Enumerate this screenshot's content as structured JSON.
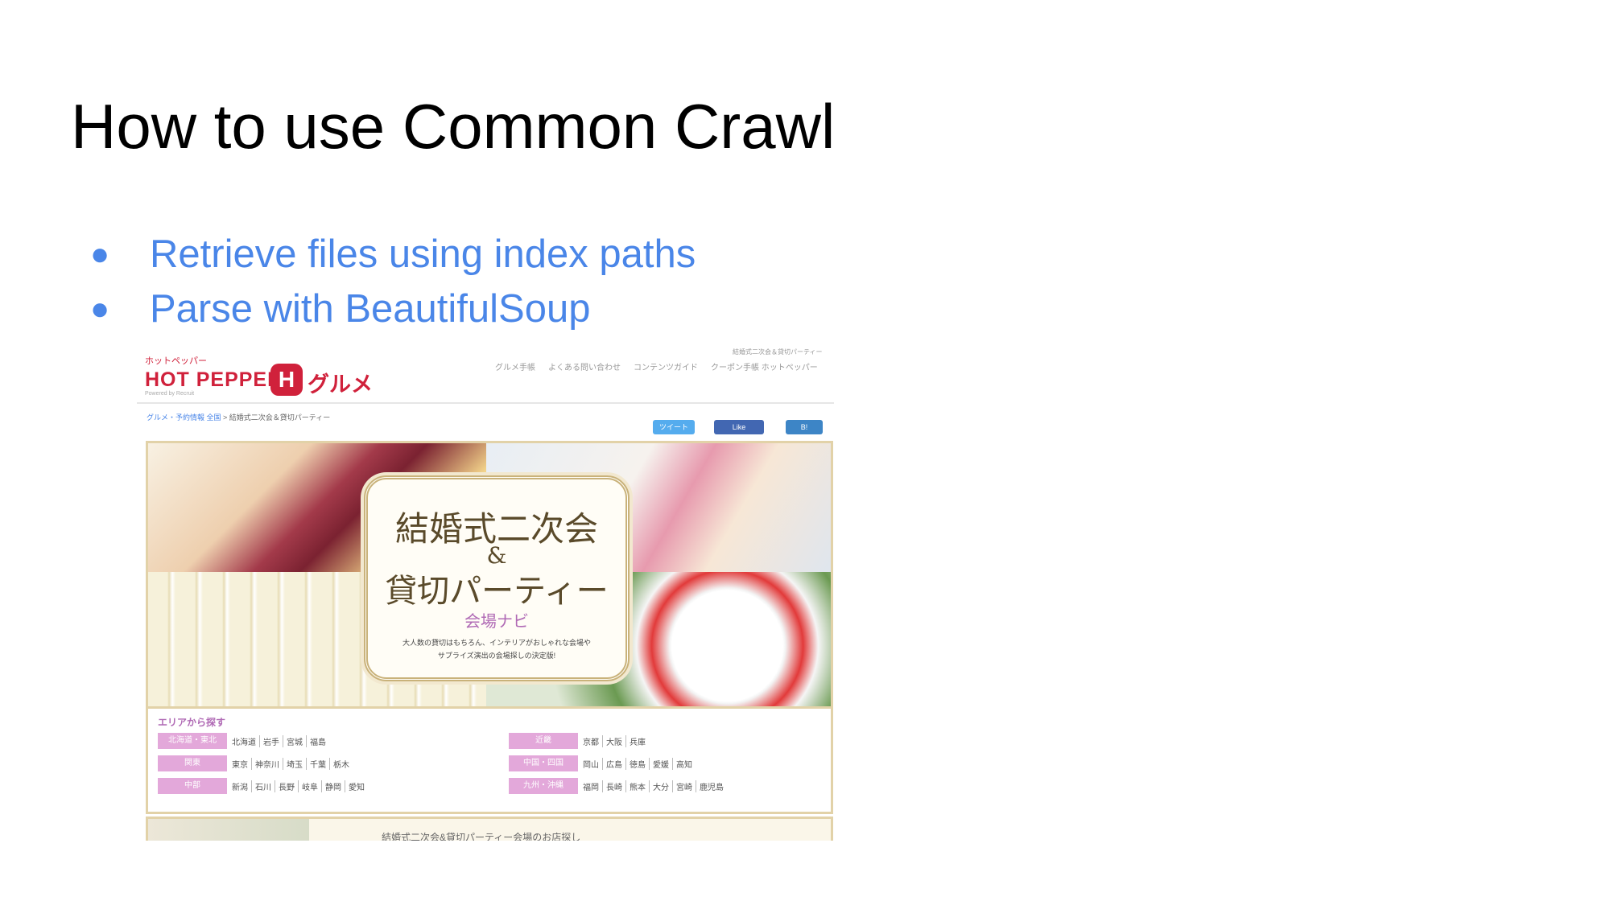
{
  "slide": {
    "title": "How to use Common Crawl",
    "bullets": [
      "Retrieve files using index paths",
      "Parse with BeautifulSoup"
    ],
    "bullet_color": "#4a86e8"
  },
  "website": {
    "logo_kana": "ホットペッパー",
    "logo_main": "HOT PEPPER",
    "logo_h": "H",
    "logo_gourmet": "グルメ",
    "logo_sub": "Powered by Recruit",
    "top_note": "結婚式二次会＆貸切パーティー",
    "nav": [
      "グルメ手帳",
      "よくある問い合わせ",
      "コンテンツガイド",
      "クーポン手帳 ホットペッパー"
    ],
    "breadcrumb_link": "グルメ・予約情報 全国",
    "breadcrumb_current": "結婚式二次会＆貸切パーティー",
    "sns": {
      "tweet": "ツイート",
      "like": "Like",
      "bookmark": "B!"
    },
    "hero": {
      "title1": "結婚式二次会",
      "amp": "&",
      "title2": "貸切パーティー",
      "subtitle": "会場ナビ",
      "desc1": "大人数の貸切はもちろん、インテリアがおしゃれな会場や",
      "desc2": "サプライズ演出の会場探しの決定版!"
    },
    "area_search": {
      "title": "エリアから探す",
      "regions": [
        {
          "name": "北海道・東北",
          "prefs": [
            "北海道",
            "岩手",
            "宮城",
            "福島"
          ]
        },
        {
          "name": "関東",
          "prefs": [
            "東京",
            "神奈川",
            "埼玉",
            "千葉",
            "栃木"
          ]
        },
        {
          "name": "中部",
          "prefs": [
            "新潟",
            "石川",
            "長野",
            "岐阜",
            "静岡",
            "愛知"
          ]
        },
        {
          "name": "近畿",
          "prefs": [
            "京都",
            "大阪",
            "兵庫"
          ]
        },
        {
          "name": "中国・四国",
          "prefs": [
            "岡山",
            "広島",
            "徳島",
            "愛媛",
            "高知"
          ]
        },
        {
          "name": "九州・沖縄",
          "prefs": [
            "福岡",
            "長崎",
            "熊本",
            "大分",
            "宮崎",
            "鹿児島"
          ]
        }
      ]
    },
    "bottom_title": "結婚式二次会&貸切パーティー会場のお店探し"
  }
}
